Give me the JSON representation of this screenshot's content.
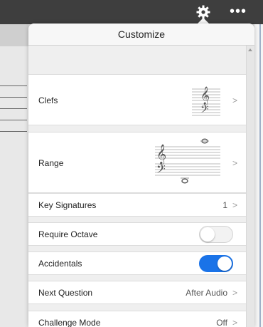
{
  "topbar": {
    "gear_icon": "gear-icon",
    "more_icon": "ellipsis-icon",
    "more_text": "•••"
  },
  "popover": {
    "title": "Customize",
    "rows": {
      "clefs": {
        "label": "Clefs",
        "chevron": ">"
      },
      "range": {
        "label": "Range",
        "chevron": ">"
      },
      "key_signatures": {
        "label": "Key Signatures",
        "value": "1",
        "chevron": ">"
      },
      "require_octave": {
        "label": "Require Octave",
        "toggle_on": false
      },
      "accidentals": {
        "label": "Accidentals",
        "toggle_on": true
      },
      "next_question": {
        "label": "Next Question",
        "value": "After Audio",
        "chevron": ">"
      },
      "challenge_mode": {
        "label": "Challenge Mode",
        "value": "Off",
        "chevron": ">"
      }
    }
  },
  "colors": {
    "topbar": "#3e3e3e",
    "toggle_on": "#1a73e8",
    "popover_bg": "#f7f7f7"
  }
}
